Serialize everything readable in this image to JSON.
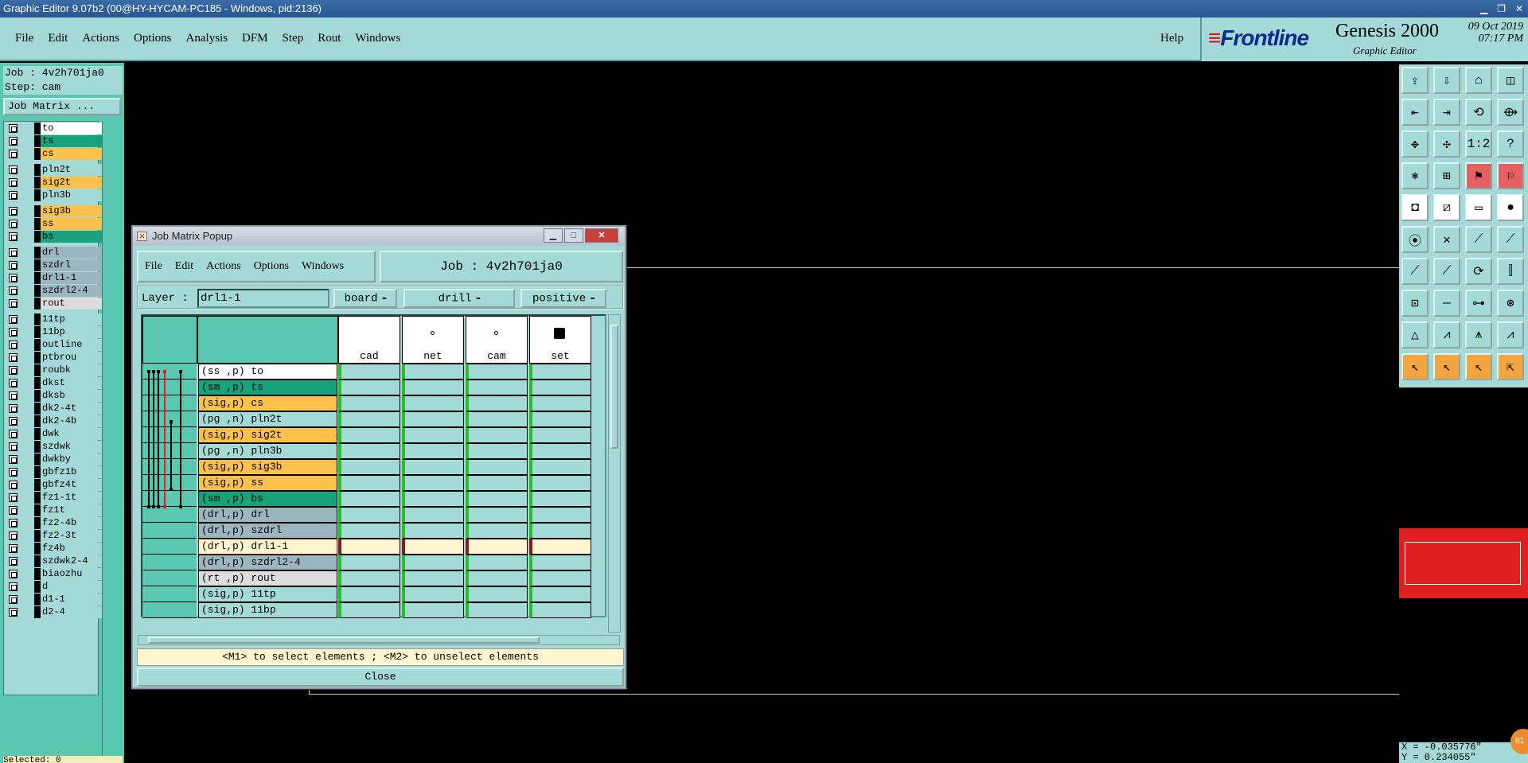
{
  "os": {
    "title": "Graphic Editor 9.07b2 (00@HY-HYCAM-PC185 - Windows, pid:2136)"
  },
  "menubar": {
    "items": [
      "File",
      "Edit",
      "Actions",
      "Options",
      "Analysis",
      "DFM",
      "Step",
      "Rout",
      "Windows"
    ],
    "help": "Help"
  },
  "brand": {
    "logo": "Frontline",
    "product": "Genesis 2000",
    "subtitle": "Graphic Editor",
    "date": "09 Oct 2019",
    "time": "07:17 PM"
  },
  "left": {
    "job": "Job : 4v2h701ja0",
    "step": "Step: cam",
    "job_matrix_button": "Job Matrix ..."
  },
  "layers": [
    {
      "name": "to",
      "color": "#ffffff"
    },
    {
      "name": "ts",
      "color": "#18a37c"
    },
    {
      "name": "cs",
      "color": "#fbc14c"
    },
    {
      "name": "pln2t",
      "color": "#a3d9d6"
    },
    {
      "name": "sig2t",
      "color": "#fbc14c"
    },
    {
      "name": "pln3b",
      "color": "#a3d9d6"
    },
    {
      "name": "sig3b",
      "color": "#fbc14c"
    },
    {
      "name": "ss",
      "color": "#fbc14c"
    },
    {
      "name": "bs",
      "color": "#18a37c"
    },
    {
      "name": "drl",
      "color": "#9cb6bf"
    },
    {
      "name": "szdrl",
      "color": "#9cb6bf"
    },
    {
      "name": "drl1-1",
      "color": "#9cb6bf"
    },
    {
      "name": "szdrl2-4",
      "color": "#9cb6bf"
    },
    {
      "name": "rout",
      "color": "#dcdcdc"
    },
    {
      "name": "11tp",
      "color": "#a3d9d6"
    },
    {
      "name": "11bp",
      "color": "#a3d9d6"
    },
    {
      "name": "outline",
      "color": "#a3d9d6"
    },
    {
      "name": "ptbrou",
      "color": "#a3d9d6"
    },
    {
      "name": "roubk",
      "color": "#a3d9d6"
    },
    {
      "name": "dkst",
      "color": "#a3d9d6"
    },
    {
      "name": "dksb",
      "color": "#a3d9d6"
    },
    {
      "name": "dk2-4t",
      "color": "#a3d9d6"
    },
    {
      "name": "dk2-4b",
      "color": "#a3d9d6"
    },
    {
      "name": "dwk",
      "color": "#a3d9d6"
    },
    {
      "name": "szdwk",
      "color": "#a3d9d6"
    },
    {
      "name": "dwkby",
      "color": "#a3d9d6"
    },
    {
      "name": "gbfz1b",
      "color": "#a3d9d6"
    },
    {
      "name": "gbfz4t",
      "color": "#a3d9d6"
    },
    {
      "name": "fz1-1t",
      "color": "#a3d9d6"
    },
    {
      "name": "fz1t",
      "color": "#a3d9d6"
    },
    {
      "name": "fz2-4b",
      "color": "#a3d9d6"
    },
    {
      "name": "fz2-3t",
      "color": "#a3d9d6"
    },
    {
      "name": "fz4b",
      "color": "#a3d9d6"
    },
    {
      "name": "szdwk2-4",
      "color": "#a3d9d6"
    },
    {
      "name": "biaozhu",
      "color": "#a3d9d6"
    },
    {
      "name": "d",
      "color": "#a3d9d6"
    },
    {
      "name": "d1-1",
      "color": "#a3d9d6"
    },
    {
      "name": "d2-4",
      "color": "#a3d9d6"
    }
  ],
  "bottom_field": "Selected: 0",
  "popup": {
    "title": "Job Matrix Popup",
    "menu": [
      "File",
      "Edit",
      "Actions",
      "Options",
      "Windows"
    ],
    "job_title": "Job : 4v2h701ja0",
    "layer_label": "Layer :",
    "layer_value": "drl1-1",
    "context": "board",
    "type": "drill",
    "polarity": "positive",
    "columns": [
      "cad",
      "net",
      "cam",
      "set"
    ],
    "rows": [
      {
        "label": "(ss ,p) to",
        "color": "#ffffff"
      },
      {
        "label": "(sm ,p) ts",
        "color": "#18a37c"
      },
      {
        "label": "(sig,p) cs",
        "color": "#fbc14c"
      },
      {
        "label": "(pg ,n) pln2t",
        "color": "#a3d9d6"
      },
      {
        "label": "(sig,p) sig2t",
        "color": "#fbc14c"
      },
      {
        "label": "(pg ,n) pln3b",
        "color": "#a3d9d6"
      },
      {
        "label": "(sig,p) sig3b",
        "color": "#fbc14c"
      },
      {
        "label": "(sig,p) ss",
        "color": "#fbc14c"
      },
      {
        "label": "(sm ,p) bs",
        "color": "#18a37c"
      },
      {
        "label": "(drl,p) drl",
        "color": "#9cb6bf"
      },
      {
        "label": "(drl,p) szdrl",
        "color": "#9cb6bf"
      },
      {
        "label": "(drl,p) drl1-1",
        "color": "#fdf6cf",
        "selected": true
      },
      {
        "label": "(drl,p) szdrl2-4",
        "color": "#9cb6bf"
      },
      {
        "label": "(rt ,p) rout",
        "color": "#dcdcdc"
      },
      {
        "label": "(sig,p) 11tp",
        "color": "#a3d9d6"
      },
      {
        "label": "(sig,p) 11bp",
        "color": "#a3d9d6"
      }
    ],
    "status": "<M1> to select elements ; <M2> to unselect elements",
    "close_label": "Close"
  },
  "coords": {
    "x": "X = -0.035776\"",
    "y": "Y = 0.234055\""
  },
  "tray_badge": "81"
}
